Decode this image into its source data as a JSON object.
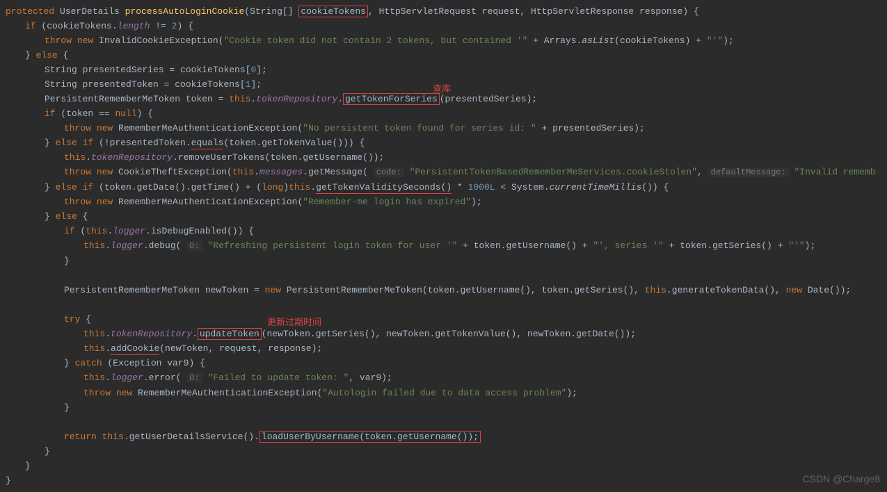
{
  "code": {
    "modifier": "protected",
    "returnType": "UserDetails ",
    "methodName": "processAutoLoginCookie",
    "paramType1": "String[] ",
    "paramName1": "cookieTokens",
    "paramRest": ", HttpServletRequest request, HttpServletResponse response) {",
    "l2_if": "if",
    "l2_rest": " (cookieTokens.",
    "l2_length": "length",
    "l2_neq": " != ",
    "l2_two": "2",
    "l2_brace": ") {",
    "l3_throw": "throw",
    "l3_new": "new",
    "l3_ex": " InvalidCookieException(",
    "l3_str": "\"Cookie token did not contain 2 tokens, but contained '\"",
    "l3_plus": " + Arrays.",
    "l3_aslist": "asList",
    "l3_rest": "(cookieTokens) + ",
    "l3_str2": "\"'\"",
    "l3_end": ");",
    "l4_else": " else {",
    "l4_brace": "} ",
    "l5_type": "String presentedSeries = cookieTokens[",
    "l5_zero": "0",
    "l5_end": "];",
    "l6_type": "String presentedToken = cookieTokens[",
    "l6_one": "1",
    "l6_end": "];",
    "l7_type": "PersistentRememberMeToken token = ",
    "l7_this": "this",
    "l7_dot": ".",
    "l7_repo": "tokenRepository",
    "l7_dot2": ".",
    "l7_method": "getTokenForSeries",
    "l7_end": "(presentedSeries);",
    "l8_if": "if",
    "l8_rest": " (token == ",
    "l8_null": "null",
    "l8_brace": ") {",
    "l9_throw": "throw",
    "l9_new": "new",
    "l9_ex": " RememberMeAuthenticationException(",
    "l9_str": "\"No persistent token found for series id: \"",
    "l9_end": " + presentedSeries);",
    "l10_else": " else if ",
    "l10_brace": "} ",
    "l10_rest": "(!presentedToken.",
    "l10_eq": "equals",
    "l10_end": "(token.getTokenValue())) {",
    "l11_this": "this",
    "l11_dot": ".",
    "l11_repo": "tokenRepository",
    "l11_end": ".removeUserTokens(token.getUsername());",
    "l12_throw": "throw",
    "l12_new": "new",
    "l12_ex": " CookieTheftException(",
    "l12_this": "this",
    "l12_dot": ".",
    "l12_msgs": "messages",
    "l12_get": ".getMessage( ",
    "l12_hint1": "code:",
    "l12_str1": " \"PersistentTokenBasedRememberMeServices.cookieStolen\"",
    "l12_comma": ", ",
    "l12_hint2": "defaultMessage:",
    "l12_str2": " \"Invalid rememb",
    "l13_else": " else if ",
    "l13_brace": "} ",
    "l13_rest": "(token.getDate().getTime() + (",
    "l13_long": "long",
    "l13_paren": ")",
    "l13_this": "this",
    "l13_dot": ".",
    "l13_method": "getTokenValiditySeconds()",
    "l13_mul": " * ",
    "l13_num": "1000L",
    "l13_lt": " < System.",
    "l13_ctm": "currentTimeMillis",
    "l13_end": "()) {",
    "l14_throw": "throw",
    "l14_new": "new",
    "l14_ex": " RememberMeAuthenticationException(",
    "l14_str": "\"Remember-me login has expired\"",
    "l14_end": ");",
    "l15_else": " else {",
    "l15_brace": "} ",
    "l16_if": "if",
    "l16_rest": " (",
    "l16_this": "this",
    "l16_dot": ".",
    "l16_logger": "logger",
    "l16_end": ".isDebugEnabled()) {",
    "l17_this": "this",
    "l17_dot": ".",
    "l17_logger": "logger",
    "l17_debug": ".debug( ",
    "l17_hint": "O:",
    "l17_str1": " \"Refreshing persistent login token for user '\"",
    "l17_mid": " + token.getUsername() + ",
    "l17_str2": "\"', series '\"",
    "l17_mid2": " + token.getSeries() + ",
    "l17_str3": "\"'\"",
    "l17_end": ");",
    "l18_brace": "}",
    "l19_type": "PersistentRememberMeToken newToken = ",
    "l19_new": "new",
    "l19_ctor": " PersistentRememberMeToken(token.getUsername(), token.getSeries(), ",
    "l19_this": "this",
    "l19_dot": ".generateTokenData(), ",
    "l19_new2": "new",
    "l19_date": " Date());",
    "l20_try": "try",
    "l20_brace": " {",
    "l21_this": "this",
    "l21_dot": ".",
    "l21_repo": "tokenRepository",
    "l21_dot2": ".",
    "l21_method": "updateToken",
    "l21_end": "(newToken.getSeries(), newToken.getTokenValue(), newToken.getDate());",
    "l22_this": "this",
    "l22_dot": ".",
    "l22_method": "addCookie",
    "l22_end": "(newToken, request, response);",
    "l23_catch": " catch ",
    "l23_brace": "} ",
    "l23_rest": "(Exception var9) {",
    "l24_this": "this",
    "l24_dot": ".",
    "l24_logger": "logger",
    "l24_error": ".error( ",
    "l24_hint": "O:",
    "l24_str": " \"Failed to update token: \"",
    "l24_end": ", var9);",
    "l25_throw": "throw",
    "l25_new": "new",
    "l25_ex": " RememberMeAuthenticationException(",
    "l25_str": "\"Autologin failed due to data access problem\"",
    "l25_end": ");",
    "l26_brace": "}",
    "l27_return": "return",
    "l27_this": "this",
    "l27_rest": ".getUserDetailsService().",
    "l27_method": "loadUserByUsername(token.getUsername());",
    "l28_brace": "}",
    "l29_brace": "}",
    "l30_brace": "}"
  },
  "annotations": {
    "a1": "查库",
    "a2": "更新过期时间"
  },
  "watermark": "CSDN @Charge8"
}
